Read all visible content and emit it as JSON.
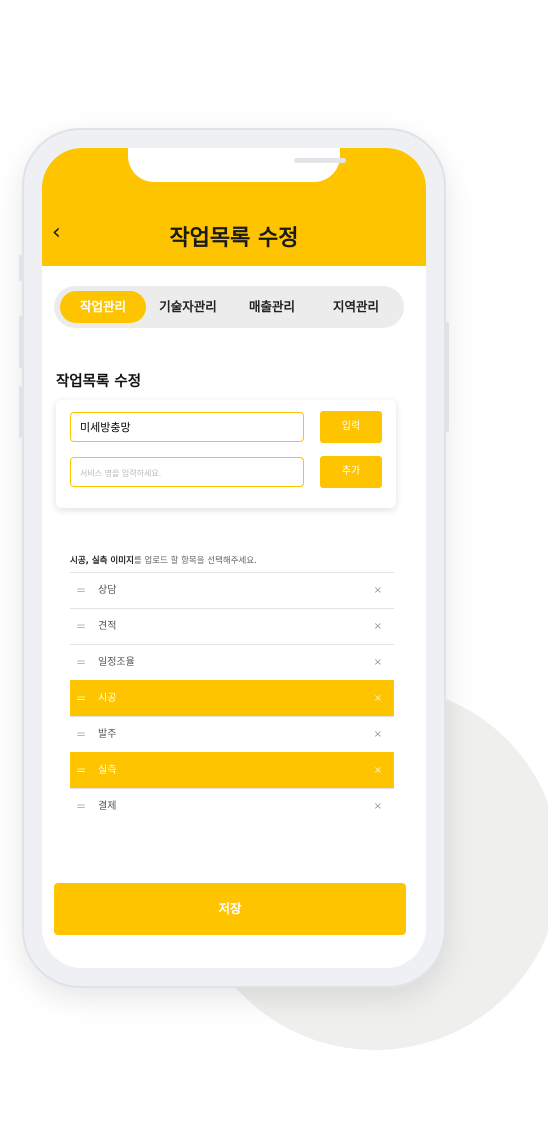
{
  "header": {
    "title": "작업목록 수정",
    "back_icon": "chevron-left-icon"
  },
  "tabs": [
    {
      "label": "작업관리",
      "active": true
    },
    {
      "label": "기술자관리",
      "active": false
    },
    {
      "label": "매출관리",
      "active": false
    },
    {
      "label": "지역관리",
      "active": false
    }
  ],
  "section": {
    "title": "작업목록 수정"
  },
  "form": {
    "name_value": "미세방충망",
    "service_placeholder": "서비스 명을 입력하세요.",
    "input_button": "입력",
    "add_button": "추가"
  },
  "hint": {
    "bold": "시공, 실측 이미지",
    "rest": "를 업로드 할 항목을 선택해주세요."
  },
  "items": [
    {
      "label": "상담",
      "selected": false
    },
    {
      "label": "견적",
      "selected": false
    },
    {
      "label": "일정조율",
      "selected": false
    },
    {
      "label": "시공",
      "selected": true
    },
    {
      "label": "발주",
      "selected": false
    },
    {
      "label": "실측",
      "selected": true
    },
    {
      "label": "결제",
      "selected": false
    }
  ],
  "icons": {
    "drag": "=",
    "remove": "×"
  },
  "save_button": "저장",
  "colors": {
    "accent": "#ffc400",
    "background_circle": "#efefed"
  }
}
